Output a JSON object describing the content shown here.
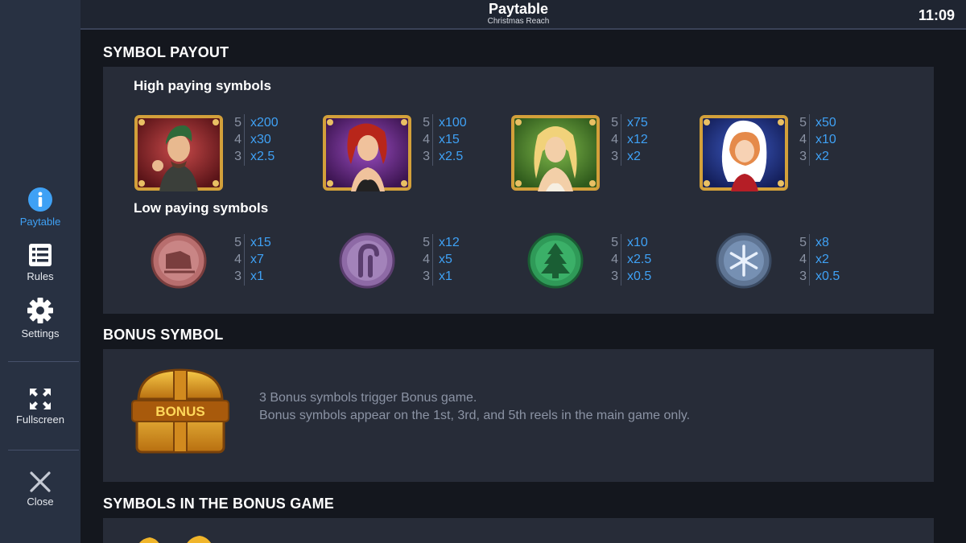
{
  "header": {
    "title": "Paytable",
    "subtitle": "Christmas Reach",
    "clock": "11:09"
  },
  "sidebar": {
    "paytable": "Paytable",
    "rules": "Rules",
    "settings": "Settings",
    "fullscreen": "Fullscreen",
    "close": "Close"
  },
  "sections": {
    "symbol_payout": "SYMBOL PAYOUT",
    "bonus_symbol": "BONUS SYMBOL",
    "bonus_game": "SYMBOLS IN THE BONUS GAME"
  },
  "high_title": "High paying symbols",
  "low_title": "Low paying symbols",
  "counts": [
    "5",
    "4",
    "3"
  ],
  "high": [
    {
      "icon": "elf-man-portrait",
      "pays": [
        "x200",
        "x30",
        "x2.5"
      ]
    },
    {
      "icon": "redhead-woman-portrait",
      "pays": [
        "x100",
        "x15",
        "x2.5"
      ]
    },
    {
      "icon": "blonde-woman-portrait",
      "pays": [
        "x75",
        "x12",
        "x2"
      ]
    },
    {
      "icon": "santa-girl-portrait",
      "pays": [
        "x50",
        "x10",
        "x2"
      ]
    }
  ],
  "low": [
    {
      "icon": "sleigh-coin",
      "color": "#b86e6e",
      "pays": [
        "x15",
        "x7",
        "x1"
      ]
    },
    {
      "icon": "candy-cane-coin",
      "color": "#8e6aa6",
      "pays": [
        "x12",
        "x5",
        "x1"
      ]
    },
    {
      "icon": "christmas-tree-coin",
      "color": "#2f9a58",
      "pays": [
        "x10",
        "x2.5",
        "x0.5"
      ]
    },
    {
      "icon": "snowflake-coin",
      "color": "#5f7594",
      "pays": [
        "x8",
        "x2",
        "x0.5"
      ]
    }
  ],
  "bonus": {
    "chest_label": "BONUS",
    "line1": "3 Bonus symbols trigger Bonus game.",
    "line2": "Bonus symbols appear on the 1st, 3rd, and 5th reels in the main game only."
  }
}
